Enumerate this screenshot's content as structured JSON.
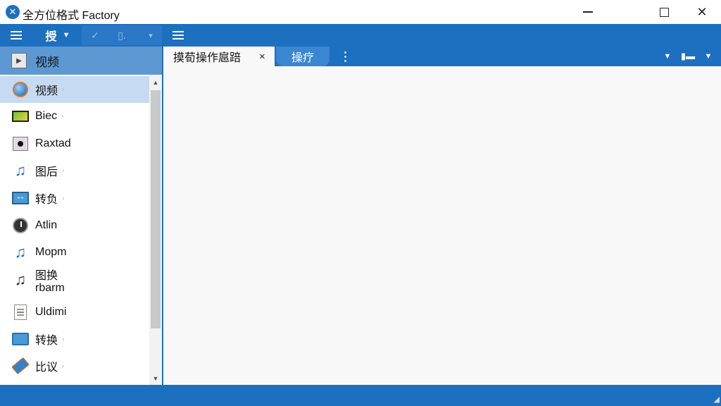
{
  "window": {
    "title": "全方位格式 Factory",
    "logo_icon": "app-logo-icon"
  },
  "toolbar": {
    "label": "授",
    "caret": "▼",
    "dim_left": "✓",
    "dim_mid": "▯.",
    "dim_caret": "▾"
  },
  "sidebar": {
    "header": "视频",
    "items": [
      {
        "label": "视频",
        "icon": "globe-icon",
        "selected": true
      },
      {
        "label": "Biec",
        "icon": "screen-icon"
      },
      {
        "label": "Raxtad",
        "icon": "disc-icon"
      },
      {
        "label": "图后",
        "icon": "music-note-icon"
      },
      {
        "label": "转负",
        "icon": "monitor-icon"
      },
      {
        "label": "Atlin",
        "icon": "clock-icon"
      },
      {
        "label": "Mopm",
        "icon": "music-note-icon"
      },
      {
        "label": "图换",
        "label2": "rbarm",
        "icon": "music-note-icon"
      },
      {
        "label": "Uldimi",
        "icon": "document-icon"
      },
      {
        "label": "转换",
        "icon": "folder-icon"
      },
      {
        "label": "比议",
        "icon": "tag-icon"
      }
    ]
  },
  "tabs": {
    "active_label": "摸荀操作扈踣",
    "close_glyph": "×",
    "second_label": "操疗"
  },
  "colors": {
    "accent": "#1d6fc0",
    "sidebar_header": "#5e98d3",
    "selected_row": "#c6dbf1",
    "content_bg": "#f8f8f8"
  }
}
